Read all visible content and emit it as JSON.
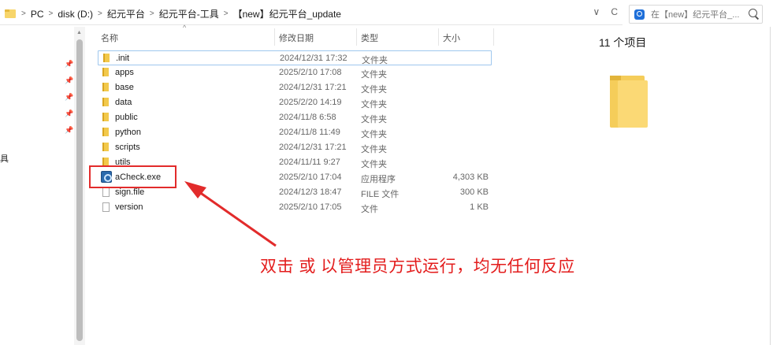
{
  "address_bar": {
    "breadcrumbs": [
      "PC",
      "disk (D:)",
      "纪元平台",
      "纪元平台-工具",
      "【new】纪元平台_update"
    ],
    "dropdown_glyph": "∨",
    "refresh_glyph": "C"
  },
  "search": {
    "placeholder": "在【new】纪元平台_..."
  },
  "nav_pane": {
    "fragment_label": "具"
  },
  "columns": {
    "name": "名称",
    "date": "修改日期",
    "type": "类型",
    "size": "大小"
  },
  "files": [
    {
      "name": ".init",
      "date": "2024/12/31 17:32",
      "type": "文件夹",
      "size": "",
      "icon": "folder-icon"
    },
    {
      "name": "apps",
      "date": "2025/2/10 17:08",
      "type": "文件夹",
      "size": "",
      "icon": "folder-icon"
    },
    {
      "name": "base",
      "date": "2024/12/31 17:21",
      "type": "文件夹",
      "size": "",
      "icon": "folder-icon"
    },
    {
      "name": "data",
      "date": "2025/2/20 14:19",
      "type": "文件夹",
      "size": "",
      "icon": "folder-icon"
    },
    {
      "name": "public",
      "date": "2024/11/8 6:58",
      "type": "文件夹",
      "size": "",
      "icon": "folder-icon"
    },
    {
      "name": "python",
      "date": "2024/11/8 11:49",
      "type": "文件夹",
      "size": "",
      "icon": "folder-icon"
    },
    {
      "name": "scripts",
      "date": "2024/12/31 17:21",
      "type": "文件夹",
      "size": "",
      "icon": "folder-icon"
    },
    {
      "name": "utils",
      "date": "2024/11/11 9:27",
      "type": "文件夹",
      "size": "",
      "icon": "folder-icon"
    },
    {
      "name": "aCheck.exe",
      "date": "2025/2/10 17:04",
      "type": "应用程序",
      "size": "4,303 KB",
      "icon": "exe-icon"
    },
    {
      "name": "sign.file",
      "date": "2024/12/3 18:47",
      "type": "FILE 文件",
      "size": "300 KB",
      "icon": "file-icon"
    },
    {
      "name": "version",
      "date": "2025/2/10 17:05",
      "type": "文件",
      "size": "1 KB",
      "icon": "file-icon"
    }
  ],
  "details_pane": {
    "item_count": "11 个项目"
  },
  "annotation": {
    "text": "双击  或 以管理员方式运行，均无任何反应",
    "color": "#e22b2b"
  }
}
